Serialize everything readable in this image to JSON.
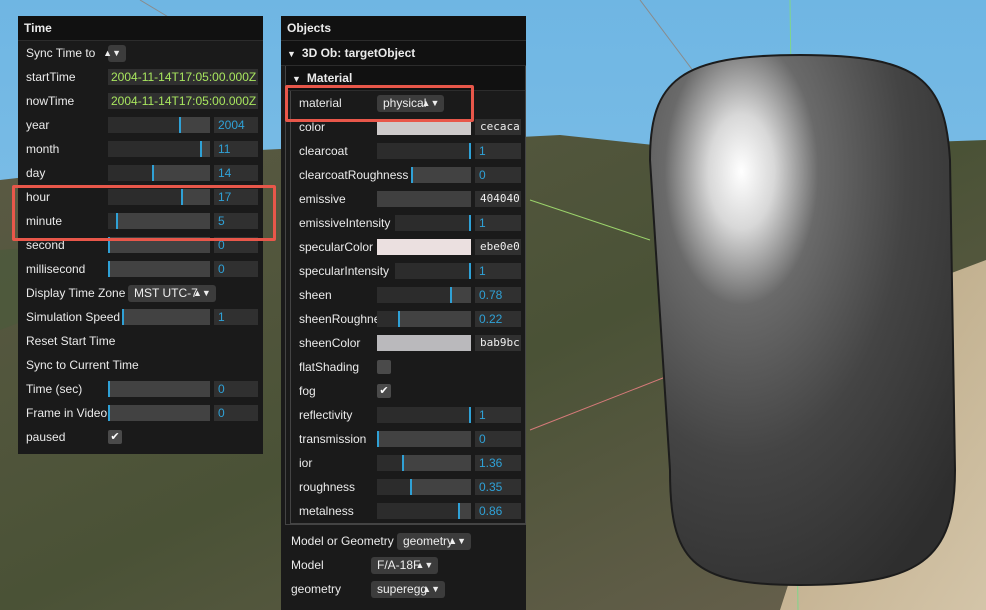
{
  "time_panel": {
    "title": "Time",
    "sync_label": "Sync Time to",
    "start_label": "startTime",
    "start_value": "2004-11-14T17:05:00.000Z",
    "now_label": "nowTime",
    "now_value": "2004-11-14T17:05:00.000Z",
    "year": {
      "label": "year",
      "value": "2004",
      "level": 0.7
    },
    "month": {
      "label": "month",
      "value": "11",
      "level": 0.9
    },
    "day": {
      "label": "day",
      "value": "14",
      "level": 0.43
    },
    "hour": {
      "label": "hour",
      "value": "17",
      "level": 0.72
    },
    "minute": {
      "label": "minute",
      "value": "5",
      "level": 0.08
    },
    "second": {
      "label": "second",
      "value": "0",
      "level": 0.0
    },
    "millisecond": {
      "label": "millisecond",
      "value": "0",
      "level": 0.0
    },
    "tz_label": "Display Time Zone",
    "tz_value": "MST UTC-7",
    "speed_label": "Simulation Speed",
    "speed_value": "1",
    "reset_label": "Reset Start Time",
    "sync_current_label": "Sync to Current Time",
    "time_sec": {
      "label": "Time (sec)",
      "value": "0",
      "level": 0.0
    },
    "frame": {
      "label": "Frame in Video",
      "value": "0",
      "level": 0.0
    },
    "paused_label": "paused",
    "paused_checked": true
  },
  "objects_panel": {
    "title": "Objects",
    "folder_object": "3D Ob: targetObject",
    "folder_material": "Material",
    "material_label": "material",
    "material_value": "physical",
    "color": {
      "label": "color",
      "hex": "cecaca",
      "swatch": "#cecaca"
    },
    "clearcoat": {
      "label": "clearcoat",
      "value": "1",
      "level": 1.0
    },
    "clearcoatRoughness": {
      "label": "clearcoatRoughness",
      "value": "0",
      "level": 0.0
    },
    "emissive": {
      "label": "emissive",
      "hex": "404040",
      "swatch": "#404040"
    },
    "emissiveIntensity": {
      "label": "emissiveIntensity",
      "value": "1",
      "level": 1.0
    },
    "specularColor": {
      "label": "specularColor",
      "hex": "ebe0e0",
      "swatch": "#ebe0e0"
    },
    "specularIntensity": {
      "label": "specularIntensity",
      "value": "1",
      "level": 1.0
    },
    "sheen": {
      "label": "sheen",
      "value": "0.78",
      "level": 0.78
    },
    "sheenRoughness": {
      "label": "sheenRoughness",
      "value": "0.22",
      "level": 0.22
    },
    "sheenColor": {
      "label": "sheenColor",
      "hex": "bab9bc",
      "swatch": "#bab9bc"
    },
    "flatShading_label": "flatShading",
    "flatShading_checked": false,
    "fog_label": "fog",
    "fog_checked": true,
    "reflectivity": {
      "label": "reflectivity",
      "value": "1",
      "level": 1.0
    },
    "transmission": {
      "label": "transmission",
      "value": "0",
      "level": 0.0
    },
    "ior": {
      "label": "ior",
      "value": "1.36",
      "level": 0.27
    },
    "roughness": {
      "label": "roughness",
      "value": "0.35",
      "level": 0.35
    },
    "metalness": {
      "label": "metalness",
      "value": "0.86",
      "level": 0.86
    },
    "model_or_geom_label": "Model or Geometry",
    "model_or_geom_value": "geometry",
    "model_label": "Model",
    "model_value": "F/A-18F",
    "geometry_label": "geometry",
    "geometry_value": "superegg"
  },
  "colors": {
    "panel_bg": "#1a1a1a",
    "number_accent": "#2fa1d6",
    "string_accent": "#a8e65e",
    "highlight": "#e8574a"
  }
}
